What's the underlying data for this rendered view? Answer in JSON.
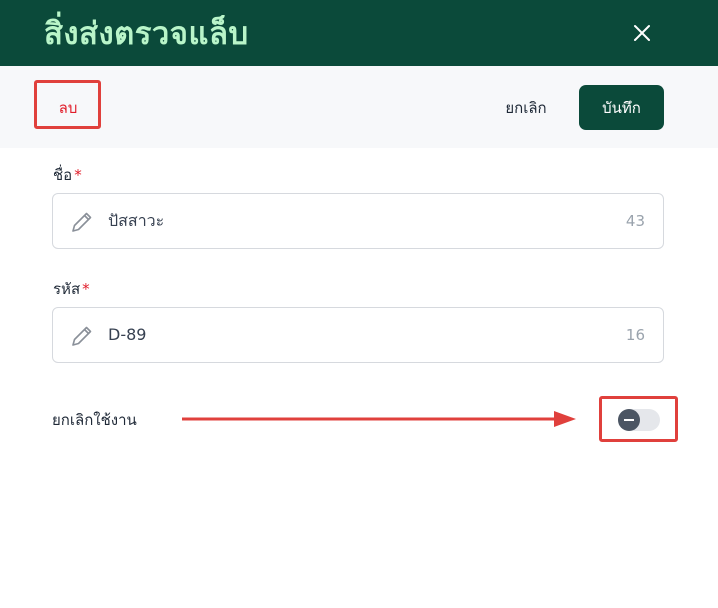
{
  "header": {
    "title": "สิ่งส่งตรวจแล็บ",
    "close_icon": "close-icon"
  },
  "toolbar": {
    "delete_label": "ลบ",
    "cancel_label": "ยกเลิก",
    "save_label": "บันทึก"
  },
  "form": {
    "name": {
      "label": "ชื่อ",
      "required_mark": "*",
      "value": "ปัสสาวะ",
      "char_count": "43",
      "icon": "pencil-icon"
    },
    "code": {
      "label": "รหัส",
      "required_mark": "*",
      "value": "D-89",
      "char_count": "16",
      "icon": "pencil-icon"
    },
    "deactivate": {
      "label": "ยกเลิกใช้งาน",
      "enabled": false
    }
  },
  "annotations": {
    "highlight_color": "#e0403c",
    "arrow_color": "#e0403c"
  },
  "colors": {
    "brand": "#0b4a3a",
    "title_text": "#b9f5c9",
    "danger": "#e11d2a"
  }
}
